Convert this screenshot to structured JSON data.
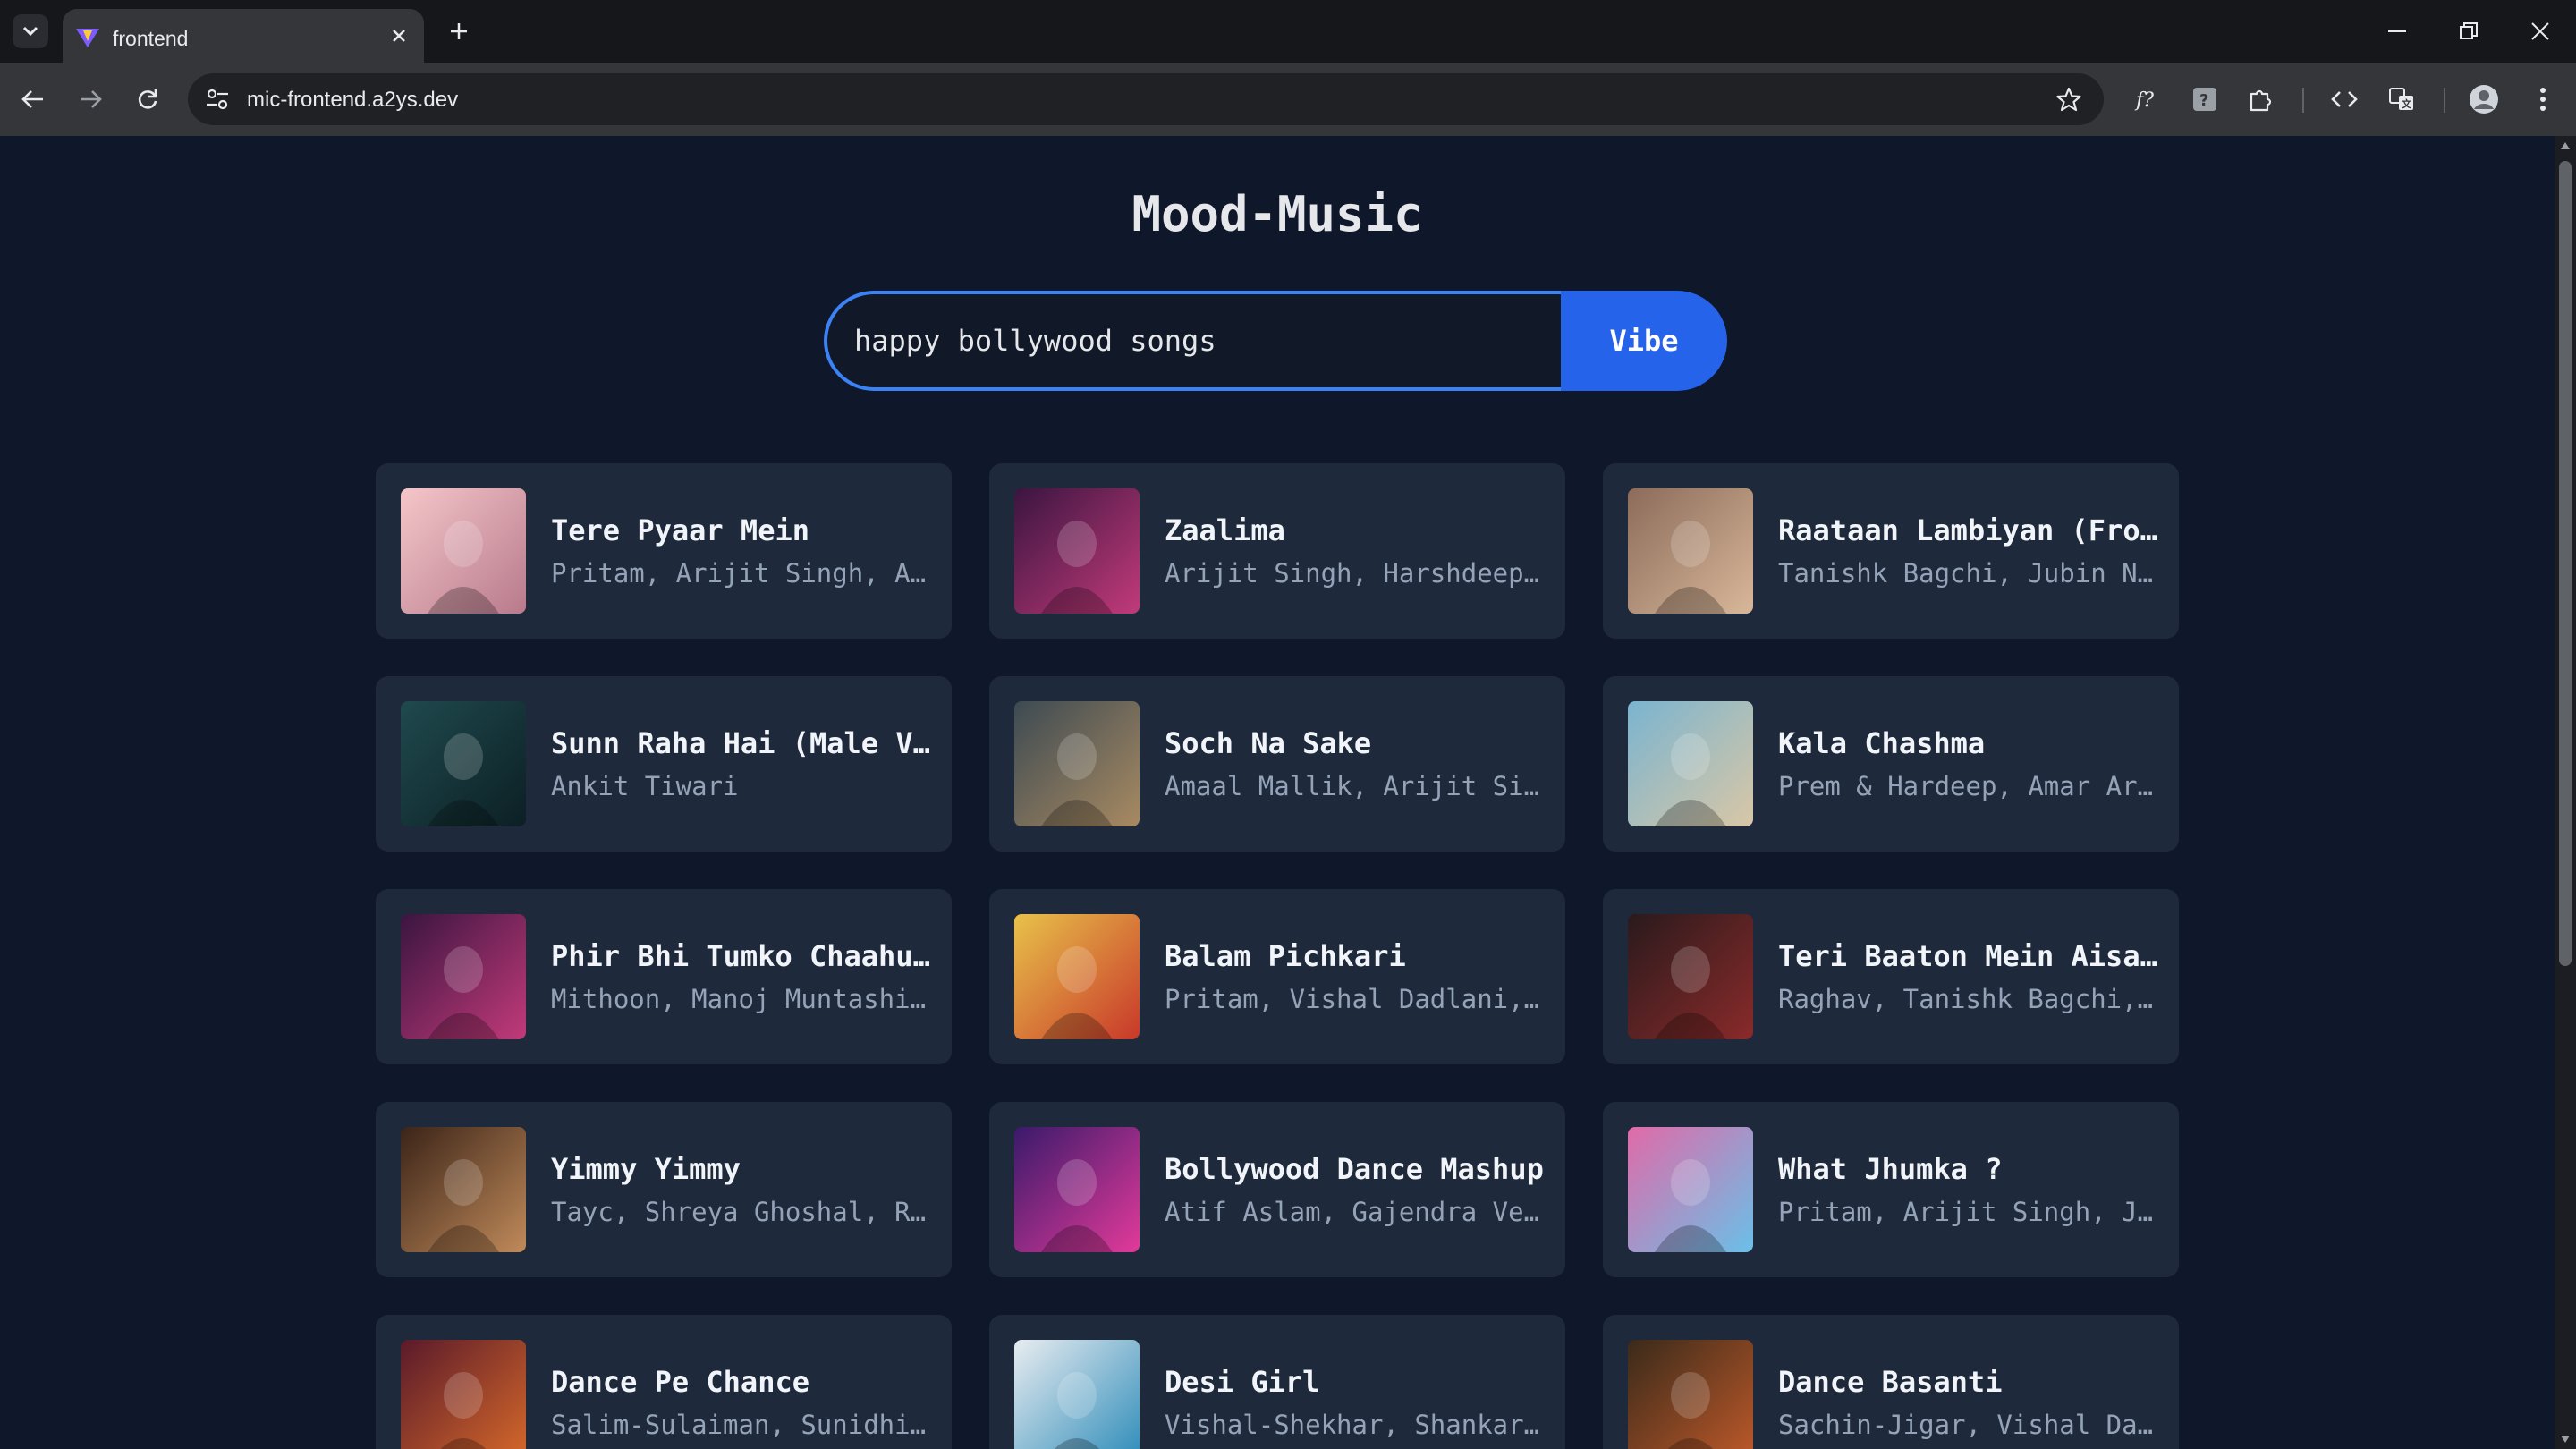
{
  "browser": {
    "tab_title": "frontend",
    "url": "mic-frontend.a2ys.dev"
  },
  "app": {
    "title": "Mood-Music",
    "search": {
      "value": "happy bollywood songs",
      "button_label": "Vibe"
    }
  },
  "songs": [
    {
      "title": "Tere Pyaar Mein",
      "artists": "Pritam, Arijit Singh, Amitabh Bhattacharya"
    },
    {
      "title": "Zaalima",
      "artists": "Arijit Singh, Harshdeep Kaur"
    },
    {
      "title": "Raataan Lambiyan (From \"Shershaah\")",
      "artists": "Tanishk Bagchi, Jubin Nautiyal, Asees Kaur"
    },
    {
      "title": "Sunn Raha Hai (Male Version)",
      "artists": "Ankit Tiwari"
    },
    {
      "title": "Soch Na Sake",
      "artists": "Amaal Mallik, Arijit Singh, Tulsi Kumar"
    },
    {
      "title": "Kala Chashma",
      "artists": "Prem & Hardeep, Amar Arshi, Badshah"
    },
    {
      "title": "Phir Bhi Tumko Chaahunga",
      "artists": "Mithoon, Manoj Muntashir, Arijit Singh"
    },
    {
      "title": "Balam Pichkari",
      "artists": "Pritam, Vishal Dadlani, Shalmali Kholgade"
    },
    {
      "title": "Teri Baaton Mein Aisa Uljha Jiya",
      "artists": "Raghav, Tanishk Bagchi, Asees Kaur"
    },
    {
      "title": "Yimmy Yimmy",
      "artists": "Tayc, Shreya Ghoshal, Rajat Nagpal"
    },
    {
      "title": "Bollywood Dance Mashup",
      "artists": "Atif Aslam, Gajendra Verma"
    },
    {
      "title": "What Jhumka ?",
      "artists": "Pritam, Arijit Singh, Jonita Gandhi"
    },
    {
      "title": "Dance Pe Chance",
      "artists": "Salim-Sulaiman, Sunidhi Chauhan"
    },
    {
      "title": "Desi Girl",
      "artists": "Vishal-Shekhar, Shankar Mahadevan"
    },
    {
      "title": "Dance Basanti",
      "artists": "Sachin-Jigar, Vishal Dadlani"
    }
  ],
  "cover_colors": [
    [
      "#f4c6c9",
      "#b87a8c"
    ],
    [
      "#3a1540",
      "#c23a7a"
    ],
    [
      "#8c6b5a",
      "#d8b79a"
    ],
    [
      "#1f4a4e",
      "#0c1f24"
    ],
    [
      "#3d4a52",
      "#a88a62"
    ],
    [
      "#7ab4d0",
      "#d9c7a6"
    ],
    [
      "#3a1540",
      "#c23a7a"
    ],
    [
      "#e8c24a",
      "#c8382a"
    ],
    [
      "#2a1a1c",
      "#8a2a2a"
    ],
    [
      "#3b2418",
      "#c08a5a"
    ],
    [
      "#3a1a6a",
      "#e23a9a"
    ],
    [
      "#e06aa8",
      "#6ac0e8"
    ],
    [
      "#5a1a2a",
      "#d86a2a"
    ],
    [
      "#e8ecf0",
      "#2a8ab8"
    ],
    [
      "#3a2a1a",
      "#c05a2a"
    ]
  ]
}
